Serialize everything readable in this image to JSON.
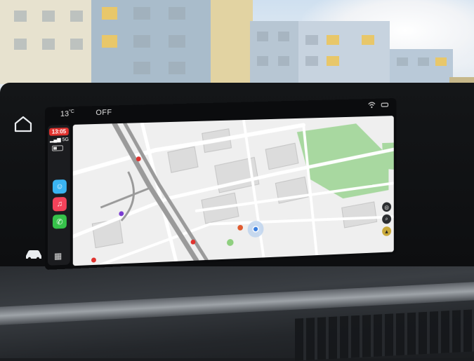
{
  "scene": {
    "description_colors": {
      "sky": "#cfe0f0",
      "building_yellow": "#e8c76a",
      "building_blue": "#a9bccb"
    }
  },
  "dashboard": {
    "home_button_icon": "home-icon",
    "car_button_icon": "car-icon"
  },
  "screen": {
    "status_bar": {
      "temperature": "13",
      "temperature_unit": "°C",
      "climate_status": "OFF",
      "icons": [
        "wifi-icon",
        "car-status-icon"
      ]
    },
    "carplay": {
      "time": "13:05",
      "network": "5G",
      "signal_icon": "signal-bars-icon",
      "apps": [
        {
          "name": "waze-icon",
          "color": "#3ab4f2"
        },
        {
          "name": "music-icon",
          "color": "#f5425a"
        },
        {
          "name": "phone-icon",
          "color": "#36c24a"
        }
      ],
      "app_grid_icon": "app-grid-icon"
    },
    "map": {
      "park_color": "#a8d8a0",
      "road_color": "#ffffff",
      "highway_color": "#9a9a9a",
      "controls": [
        "layers-icon",
        "search-icon",
        "report-icon"
      ]
    }
  }
}
